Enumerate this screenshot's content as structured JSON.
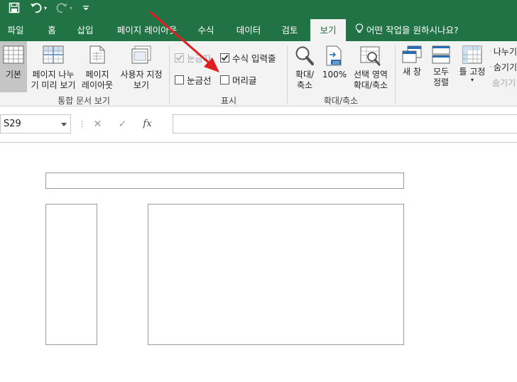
{
  "qat": {
    "save_icon": "save-icon",
    "undo_icon": "undo-icon",
    "redo_icon": "redo-icon",
    "customize_icon": "customize-qat-icon"
  },
  "tabs": [
    "파일",
    "홈",
    "삽입",
    "페이지 레이아웃",
    "수식",
    "데이터",
    "검토",
    "보기"
  ],
  "active_tab": "보기",
  "tell_me": "어떤 작업을 원하시나요?",
  "ribbon": {
    "workbook_views": {
      "label": "통합 문서 보기",
      "buttons": [
        "기본",
        "페이지 나누\n기 미리 보기",
        "페이지\n레이아웃",
        "사용자 지정\n보기"
      ]
    },
    "show": {
      "label": "표시",
      "ruler": "눈금자",
      "formula_bar": "수식 입력줄",
      "gridlines": "눈금선",
      "headings": "머리글"
    },
    "zoom": {
      "label": "확대/축소",
      "buttons": [
        "확대/\n축소",
        "100%",
        "선택 영역\n확대/축소"
      ]
    },
    "window": {
      "buttons": [
        "새 창",
        "모두\n정렬",
        "틀 고정"
      ],
      "small": [
        "나누기",
        "숨기기",
        "숨기기 취소"
      ]
    }
  },
  "formula_bar": {
    "name_box": "S29",
    "fx": "fx",
    "cancel": "✕",
    "enter": "✓",
    "more": "⋮"
  },
  "colors": {
    "excel_green": "#217346",
    "arrow_red": "#e02020"
  }
}
